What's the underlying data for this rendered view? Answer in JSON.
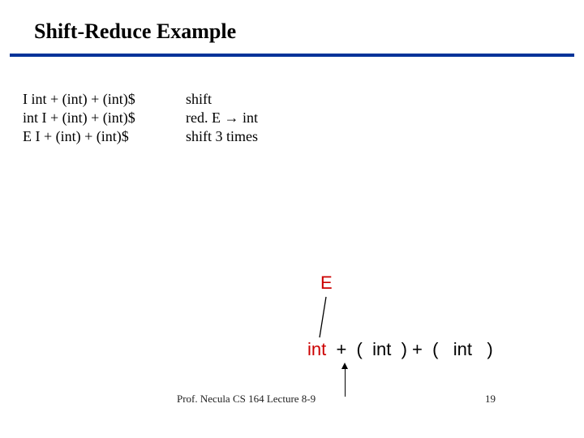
{
  "title": "Shift-Reduce Example",
  "steps": [
    {
      "left": "I int + (int) + (int)$",
      "right": "shift"
    },
    {
      "left": "int I + (int) + (int)$",
      "right": "red. E → int"
    },
    {
      "left": "E I + (int) + (int)$",
      "right": "shift 3 times"
    }
  ],
  "tree": {
    "nodeE": "E",
    "tokens": [
      {
        "text": "int",
        "color": "red"
      },
      {
        "text": "  +  (  ",
        "color": "black"
      },
      {
        "text": "int",
        "color": "black"
      },
      {
        "text": "  ) +  (   ",
        "color": "black"
      },
      {
        "text": "int",
        "color": "black"
      },
      {
        "text": "   )",
        "color": "black"
      }
    ]
  },
  "footer": {
    "left": "Prof. Necula  CS 164  Lecture 8-9",
    "right": "19"
  }
}
